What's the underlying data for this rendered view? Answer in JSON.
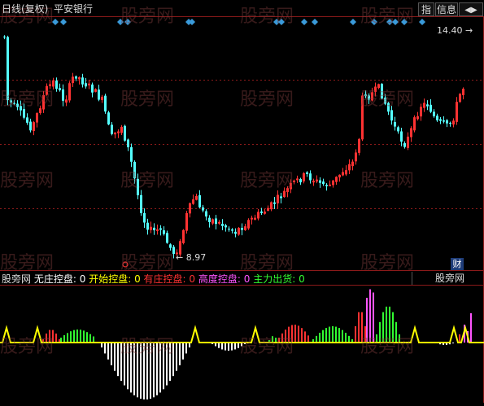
{
  "header": {
    "period_label": "日线(复权)",
    "stock_name": "平安银行"
  },
  "toolbar": {
    "index_button": "指",
    "info_button": "信息",
    "nav_button": "◀▶"
  },
  "price_chart": {
    "high_label": "14.40",
    "low_label": "8.97",
    "finance_badge": "财",
    "grid_visible": true,
    "up_color": "#ff3232",
    "down_color": "#54ffff",
    "signal_marker_color": "#3a9ad9",
    "chart_data": {
      "type": "candlestick",
      "high": 14.4,
      "low": 8.97,
      "bars": 142
    }
  },
  "indicator": {
    "title": "股旁网",
    "selector_label": "股旁网",
    "legend": [
      {
        "name": "无庄控盘",
        "value": "0",
        "color": "#ffffff"
      },
      {
        "name": "开始控盘",
        "value": "0",
        "color": "#ffff00"
      },
      {
        "name": "有庄控盘",
        "value": "0",
        "color": "#ff3232"
      },
      {
        "name": "高度控盘",
        "value": "0",
        "color": "#ff55ff"
      },
      {
        "name": "主力出货",
        "value": "0",
        "color": "#32ff32"
      }
    ]
  },
  "watermark": "股旁网"
}
